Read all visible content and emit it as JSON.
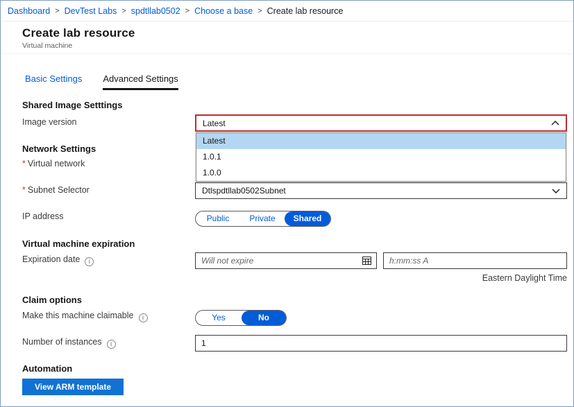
{
  "breadcrumb": {
    "separator": ">",
    "items": [
      {
        "label": "Dashboard"
      },
      {
        "label": "DevTest Labs"
      },
      {
        "label": "spdtllab0502"
      },
      {
        "label": "Choose a base"
      },
      {
        "label": "Create lab resource"
      }
    ]
  },
  "header": {
    "title": "Create lab resource",
    "subtitle": "Virtual machine"
  },
  "tabs": [
    {
      "label": "Basic Settings",
      "active": false
    },
    {
      "label": "Advanced Settings",
      "active": true
    }
  ],
  "form": {
    "required_marker": "*",
    "shared_image": {
      "heading": "Shared Image Setttings",
      "image_version": {
        "label": "Image version",
        "value": "Latest",
        "dropdown_open": true,
        "options": [
          "Latest",
          "1.0.1",
          "1.0.0"
        ],
        "selected_option": "Latest"
      }
    },
    "network": {
      "heading": "Network Settings",
      "virtual_network_label": "Virtual network",
      "subnet_selector_label": "Subnet Selector",
      "subnet_value": "Dtlspdtllab0502Subnet"
    },
    "ip_address": {
      "label": "IP address",
      "options": [
        "Public",
        "Private",
        "Shared"
      ],
      "selected": "Shared"
    },
    "expiration": {
      "heading": "Virtual machine expiration",
      "date_label": "Expiration date",
      "date_placeholder": "Will not expire",
      "time_placeholder": "h:mm:ss A",
      "timezone_note": "Eastern Daylight Time"
    },
    "claim": {
      "heading": "Claim options",
      "claimable_label": "Make this machine claimable",
      "claimable_options": [
        "Yes",
        "No"
      ],
      "claimable_selected": "No",
      "instances_label": "Number of instances",
      "instances_value": "1"
    },
    "automation": {
      "heading": "Automation",
      "view_arm_button_label": "View ARM template"
    }
  },
  "icons": {
    "info_glyph": "i"
  },
  "colors": {
    "link_blue": "#015cda",
    "pill_selected_blue": "#015cda",
    "dropdown_selected_bg": "#b3d7f2",
    "attention_border_red": "#c02b30",
    "required_red": "#d13438",
    "button_blue": "#1172d4",
    "tab_active_underline": "#161616"
  }
}
